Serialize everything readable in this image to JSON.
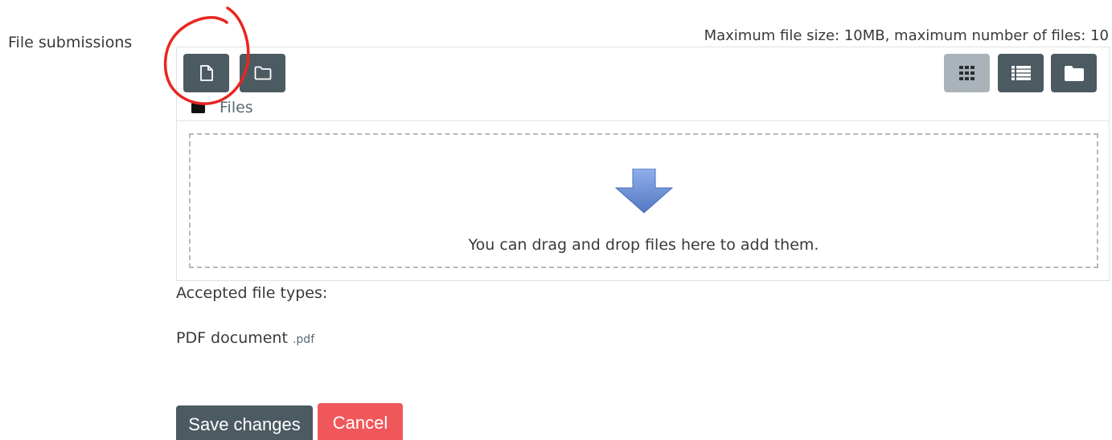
{
  "field": {
    "label": "File submissions",
    "limits": "Maximum file size: 10MB, maximum number of files: 10"
  },
  "filemanager": {
    "toolbar": {
      "add_file_icon": "file-icon",
      "create_folder_icon": "folder-icon",
      "view_icons_icon": "grid-icon",
      "view_list_icon": "list-icon",
      "view_tree_icon": "folder-solid-icon"
    },
    "path": {
      "icon": "folder-solid-icon",
      "label": "Files"
    },
    "dropzone": {
      "text": "You can drag and drop files here to add them.",
      "arrow_color": "#6b8fd4"
    }
  },
  "accepted": {
    "title": "Accepted file types:",
    "types": [
      {
        "name": "PDF document",
        "ext": ".pdf"
      }
    ]
  },
  "actions": {
    "save_label": "Save changes",
    "cancel_label": "Cancel"
  },
  "colors": {
    "button_dark": "#4c5a62",
    "button_active": "#aab3ba",
    "cancel": "#f0575a",
    "annotation_circle": "#e8261f"
  }
}
